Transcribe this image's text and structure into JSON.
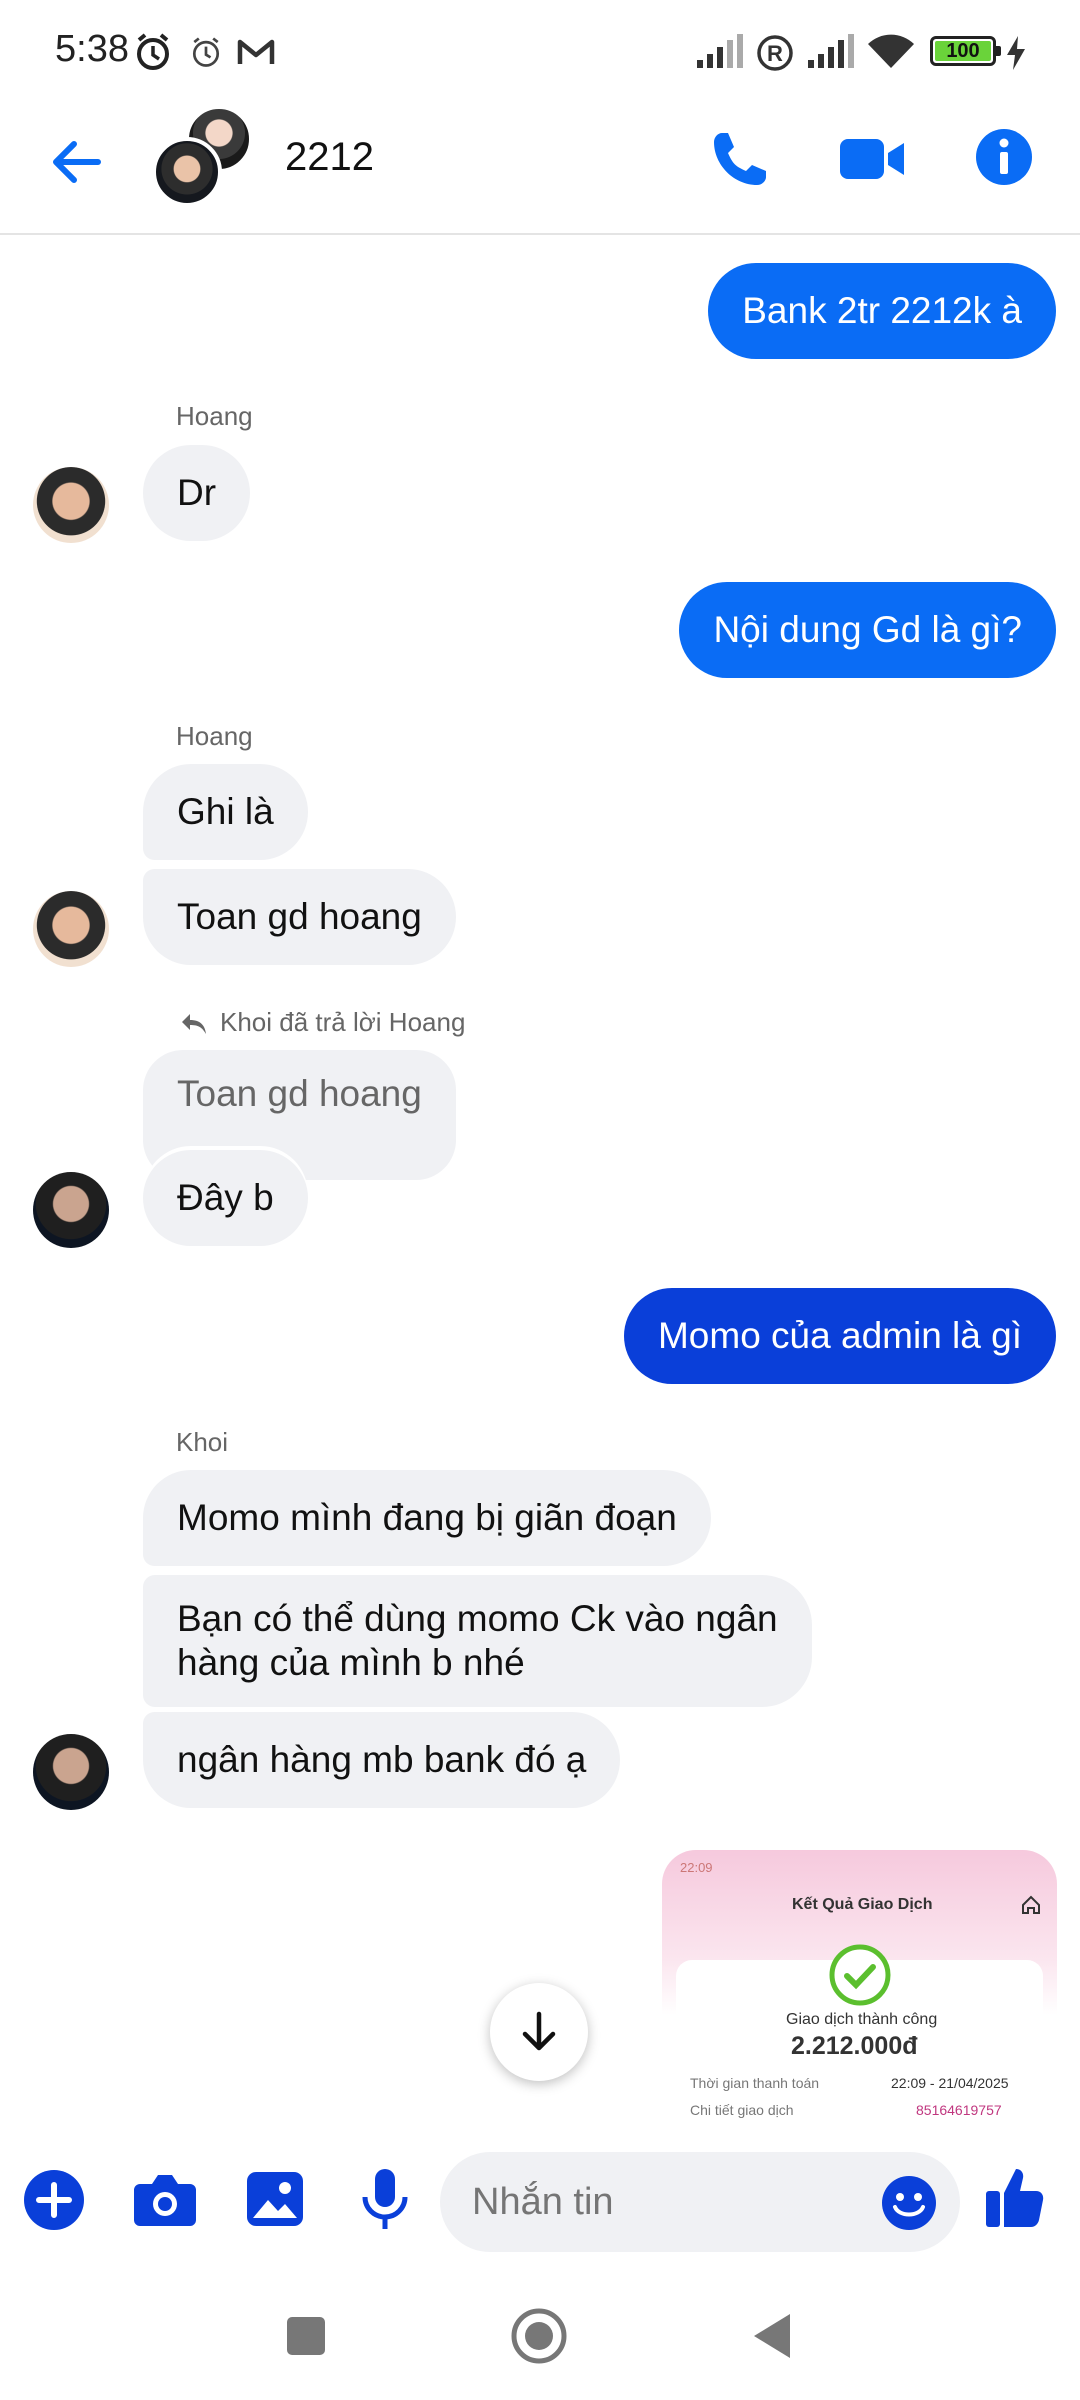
{
  "status_bar": {
    "time": "5:38",
    "battery": "100",
    "icons": [
      "alarm-icon",
      "alarm-clock-icon",
      "gmail-icon",
      "signal-icon",
      "roaming-icon",
      "signal-icon",
      "wifi-icon",
      "battery-icon",
      "charging-icon"
    ]
  },
  "header": {
    "title": "2212",
    "back_icon": "arrow-left-icon",
    "actions": [
      "phone-icon",
      "video-camera-icon",
      "info-icon"
    ],
    "accent": "#0a6cf5"
  },
  "messages": [
    {
      "direction": "out",
      "text": "Bank 2tr 2212k à"
    },
    {
      "direction": "in",
      "sender": "Hoang",
      "texts": [
        "Dr"
      ]
    },
    {
      "direction": "out",
      "text": "Nội dung Gd là gì?"
    },
    {
      "direction": "in",
      "sender": "Hoang",
      "texts": [
        "Ghi là",
        "Toan gd hoang"
      ]
    },
    {
      "direction": "in",
      "reply_label": "Khoi đã trả lời Hoang",
      "quoted": "Toan gd hoang",
      "texts": [
        "Đây b"
      ]
    },
    {
      "direction": "out",
      "text": "Momo của admin là gì"
    },
    {
      "direction": "in",
      "sender": "Khoi",
      "texts": [
        "Momo mình đang bị giãn đoạn",
        "Bạn có thể dùng momo Ck vào ngân",
        "hàng của mình b nhé",
        "ngân hàng mb bank đó ạ"
      ]
    }
  ],
  "attachment": {
    "status_time": "22:09",
    "title": "Kết Quả Giao Dịch",
    "status": "Giao dịch thành công",
    "amount": "2.212.000đ",
    "row1_label": "Thời gian thanh toán",
    "row1_value": "22:09 - 21/04/2025",
    "row2_label": "Chi tiết giao dịch",
    "row2_value": "85164619757"
  },
  "composer": {
    "placeholder": "Nhắn tin",
    "tools": [
      "plus-icon",
      "camera-icon",
      "image-icon",
      "microphone-icon",
      "emoji-icon",
      "thumbs-up-icon"
    ]
  },
  "colors": {
    "outgoing_bubble": "#0a6cf5",
    "outgoing_bubble_dark": "#0a3fd9",
    "incoming_bubble": "#f0f1f4"
  }
}
